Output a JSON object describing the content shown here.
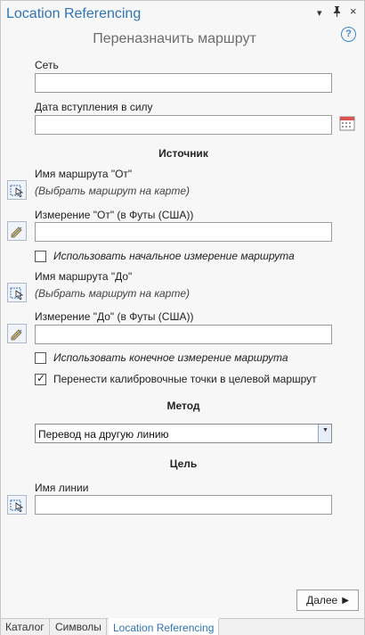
{
  "pane": {
    "title": "Location Referencing",
    "subtitle": "Переназначить маршрут",
    "help_glyph": "?",
    "controls": {
      "menu": "▾",
      "pin": "⌥",
      "close": "×"
    }
  },
  "form": {
    "network": {
      "label": "Сеть",
      "value": ""
    },
    "effective_date": {
      "label": "Дата вступления в силу",
      "value": ""
    },
    "source": {
      "header": "Источник",
      "from_route": {
        "label": "Имя маршрута \"От\"",
        "hint": "(Выбрать маршрут на карте)"
      },
      "from_measure": {
        "label": "Измерение \"От\" (в Футы (США))",
        "value": ""
      },
      "use_start_measure": {
        "label": "Использовать начальное измерение маршрута",
        "checked": false
      },
      "to_route": {
        "label": "Имя маршрута \"До\"",
        "hint": "(Выбрать маршрут на карте)"
      },
      "to_measure": {
        "label": "Измерение \"До\" (в Футы (США))",
        "value": ""
      },
      "use_end_measure": {
        "label": "Использовать конечное измерение маршрута",
        "checked": false
      },
      "transfer_calibration": {
        "label": "Перенести калибровочные точки в целевой маршрут",
        "checked": true,
        "mark": "✓"
      }
    },
    "method": {
      "header": "Метод",
      "selected": "Перевод на другую линию",
      "dropdown_glyph": "▼"
    },
    "target": {
      "header": "Цель",
      "line_name": {
        "label": "Имя линии",
        "value": ""
      }
    }
  },
  "footer": {
    "next_label": "Далее",
    "next_arrow": "▶"
  },
  "tabs": [
    {
      "label": "Каталог"
    },
    {
      "label": "Символы"
    },
    {
      "label": "Location Referencing",
      "active": true
    }
  ],
  "colors": {
    "accent": "#2f75b5",
    "subtitle": "#6e6e6e",
    "help": "#3c86d6"
  }
}
